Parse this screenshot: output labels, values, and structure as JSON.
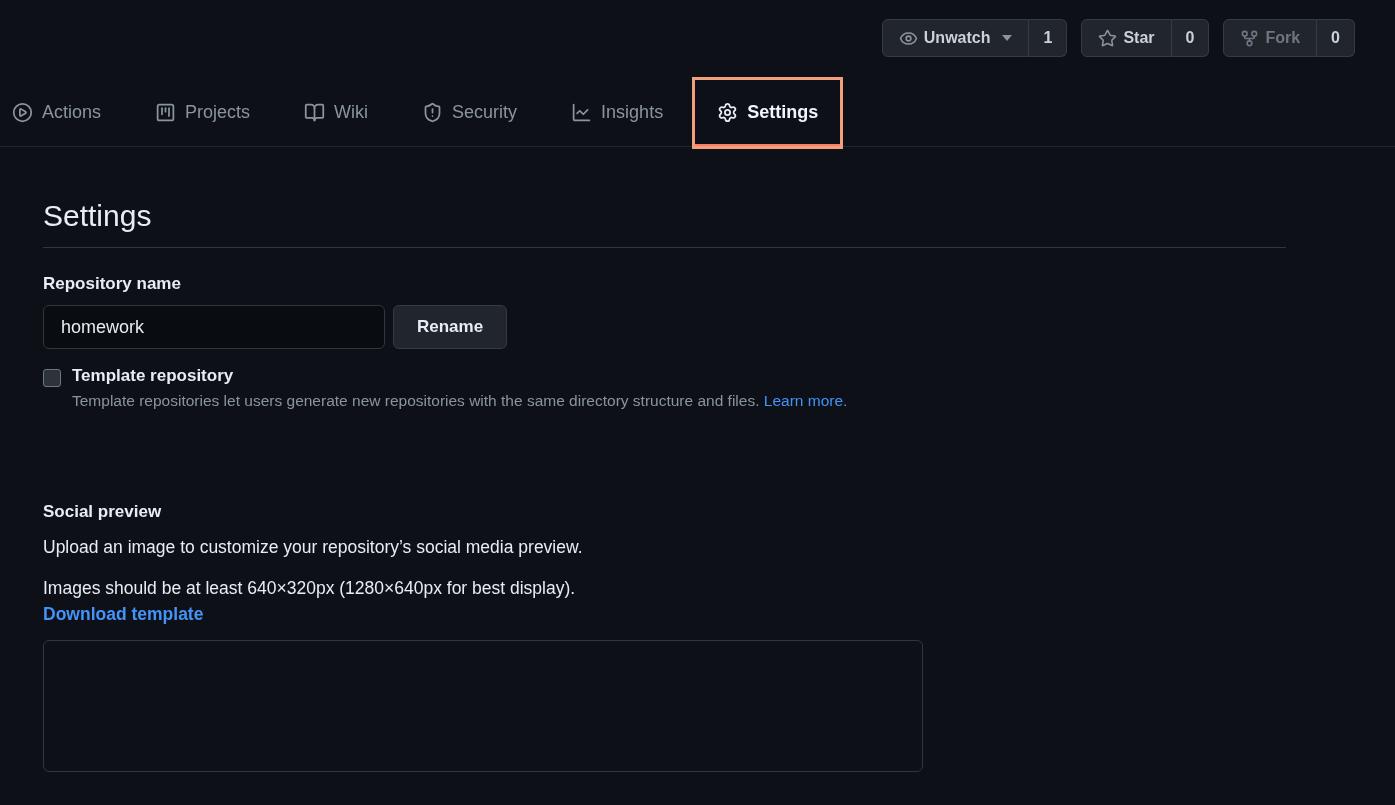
{
  "repo_actions": [
    {
      "kind": "watch",
      "label": "Unwatch",
      "count": "1",
      "disabled": false,
      "dropdown": true
    },
    {
      "kind": "star",
      "label": "Star",
      "count": "0",
      "disabled": false,
      "dropdown": false
    },
    {
      "kind": "fork",
      "label": "Fork",
      "count": "0",
      "disabled": true,
      "dropdown": false
    }
  ],
  "tabs": [
    {
      "kind": "actions",
      "label": "Actions",
      "selected": false,
      "highlighted": false
    },
    {
      "kind": "projects",
      "label": "Projects",
      "selected": false,
      "highlighted": false
    },
    {
      "kind": "wiki",
      "label": "Wiki",
      "selected": false,
      "highlighted": false
    },
    {
      "kind": "security",
      "label": "Security",
      "selected": false,
      "highlighted": false
    },
    {
      "kind": "insights",
      "label": "Insights",
      "selected": false,
      "highlighted": false
    },
    {
      "kind": "settings",
      "label": "Settings",
      "selected": true,
      "highlighted": true
    }
  ],
  "page_title": "Settings",
  "repository_name": {
    "label": "Repository name",
    "value": "homework",
    "button": "Rename"
  },
  "template": {
    "label": "Template repository",
    "checked": false,
    "description": "Template repositories let users generate new repositories with the same directory structure and files.",
    "link": "Learn more."
  },
  "social_preview": {
    "heading": "Social preview",
    "text": "Upload an image to customize your repository’s social media preview.",
    "requirement": "Images should be at least 640×320px (1280×640px for best display).",
    "link": "Download template"
  }
}
